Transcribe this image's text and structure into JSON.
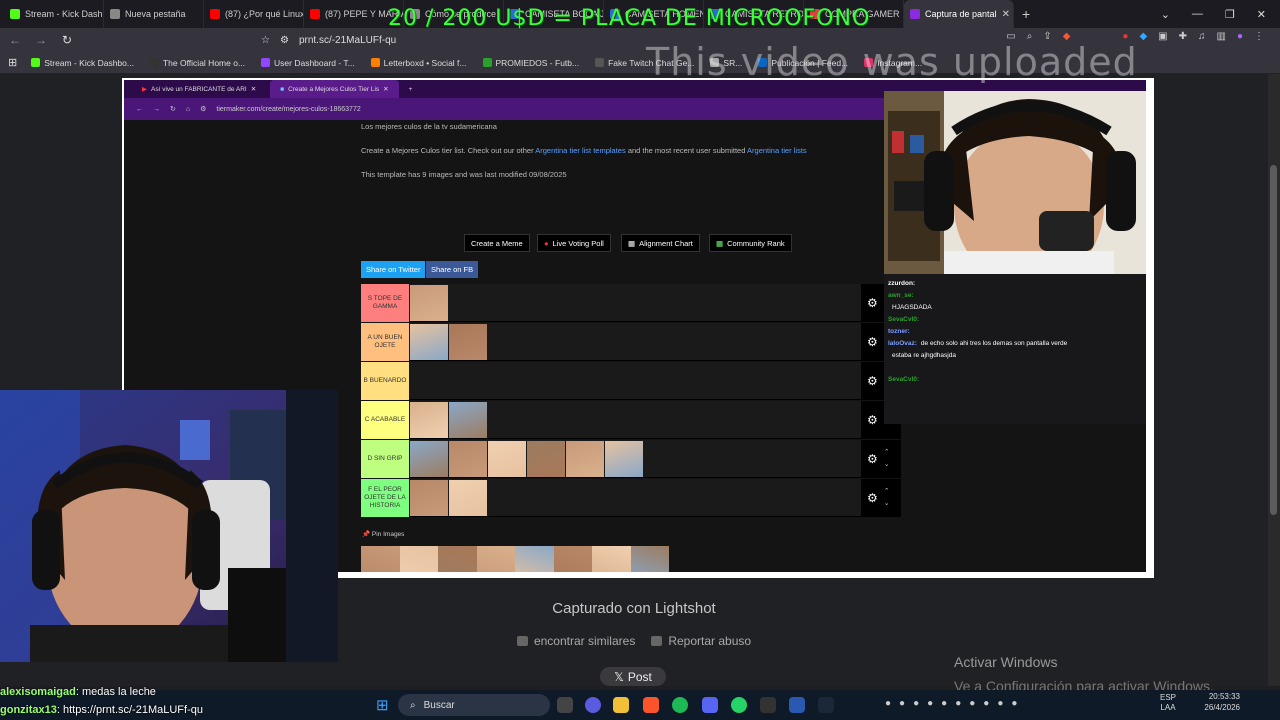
{
  "browser": {
    "tabs": [
      {
        "label": "Stream - Kick Dashboa",
        "color": "#53fc18",
        "active": false
      },
      {
        "label": "Nueva pestaña",
        "color": "#888888",
        "active": false
      },
      {
        "label": "(87) ¿Por qué Linux AH",
        "color": "#ff0000",
        "active": false
      },
      {
        "label": "(87) PEPE Y MARIAELE",
        "color": "#ff0000",
        "active": false
      },
      {
        "label": "Cómo se produce",
        "color": "#888888",
        "active": false
      },
      {
        "label": "CAMISETA BOCA JUN",
        "color": "#2b6bd6",
        "active": false
      },
      {
        "label": "CAMISETA HOMENAJ",
        "color": "#2b6bd6",
        "active": false
      },
      {
        "label": "CAMISETA RETRO - BO",
        "color": "#2b6bd6",
        "active": false
      },
      {
        "label": "COMPRA GAMER",
        "color": "#e04040",
        "active": false
      },
      {
        "label": "Captura de pantal",
        "color": "#8a2be2",
        "active": true
      }
    ],
    "url": "prnt.sc/-21MaLUFf-qu",
    "bookmarks": [
      {
        "label": "Stream - Kick Dashbo...",
        "color": "#53fc18"
      },
      {
        "label": "The Official Home o...",
        "color": "#333333"
      },
      {
        "label": "User Dashboard - T...",
        "color": "#9146ff"
      },
      {
        "label": "Letterboxd • Social f...",
        "color": "#ff8000"
      },
      {
        "label": "PROMIEDOS - Futb...",
        "color": "#2ca02c"
      },
      {
        "label": "Fake Twitch Chat Ge...",
        "color": "#555555"
      },
      {
        "label": "SR...",
        "color": "#aaaaaa"
      },
      {
        "label": "Publicación | Feed...",
        "color": "#0a66c2"
      },
      {
        "label": "Instagram...",
        "color": "#e1306c"
      }
    ]
  },
  "overlay": {
    "title": "20 / 200 U$D = PLACA DE MICROOFONO",
    "watermark": "This video was uploaded"
  },
  "inner_browser": {
    "tabs": [
      "Así vive un FABRICANTE de ARI",
      "Create a Mejores Culos Tier Lis"
    ],
    "url": "tiermaker.com/create/mejores-culos-18663772"
  },
  "tiermaker": {
    "subtitle": "Los mejores culos de la tv sudamericana",
    "desc_pre": "Create a Mejores Culos tier list. Check out our other",
    "desc_link1": "Argentina tier list templates",
    "desc_mid": "and the most recent user submitted",
    "desc_link2": "Argentina tier lists",
    "meta": "This template has 9 images and was last modified 09/08/2025",
    "buttons": [
      "Create a Meme",
      "Live Voting Poll",
      "Alignment Chart",
      "Community Rank"
    ],
    "share": [
      "Share on Twitter",
      "Share on FB"
    ],
    "tiers": [
      {
        "label": "S TOPE DE GAMMA",
        "color": "#ff7f7f",
        "images": 1
      },
      {
        "label": "A UN BUEN OJETE",
        "color": "#ffbf7f",
        "images": 2
      },
      {
        "label": "B BUENARDO",
        "color": "#ffdf7f",
        "images": 0
      },
      {
        "label": "C ACABABLE",
        "color": "#ffff7f",
        "images": 2
      },
      {
        "label": "D SIN GRIP",
        "color": "#bfff7f",
        "images": 6
      },
      {
        "label": "F EL PEOR OJETE DE LA HISTORIA",
        "color": "#7fff7f",
        "images": 2
      }
    ],
    "pin_label": "Pin Images",
    "pin_count": 8
  },
  "stream_chat": [
    {
      "user": "zzurdon:",
      "msg": "",
      "color": "#ffffff"
    },
    {
      "user": "awn_se:",
      "msg": "",
      "color": "#29a329"
    },
    {
      "user": "",
      "msg": "HJAGSDADA",
      "color": "#ff4d4d"
    },
    {
      "user": "SevaCvl0:",
      "msg": "",
      "color": "#29a329"
    },
    {
      "user": "tozner:",
      "msg": "",
      "color": "#7f9fff"
    },
    {
      "user": "laloOvaz:",
      "msg": "de echo solo ahi tres los demas son pantalla verde",
      "color": "#7f9fff"
    },
    {
      "user": "",
      "msg": "estaba re ajhgdhasjda",
      "color": "#ff4d4d"
    },
    {
      "user": "",
      "msg": "",
      "color": "#ff4d4d"
    },
    {
      "user": "SevaCvl0:",
      "msg": "",
      "color": "#29a329"
    }
  ],
  "lightshot": {
    "captured": "Capturado con Lightshot",
    "similar": "encontrar similares",
    "report": "Reportar abuso",
    "post": "Post"
  },
  "windows": {
    "activate": "Activar Windows",
    "activate_sub": "Ve a Configuración para activar Windows.",
    "search": "Buscar",
    "time": "20:53:33",
    "date": "26/4/2026",
    "lang1": "ESP",
    "lang2": "LAA"
  },
  "overlay_chat": [
    {
      "user": "alexisomaigad",
      "msg": ": medas la leche"
    },
    {
      "user": "gonzitax13",
      "msg": ": https://prnt.sc/-21MaLUFf-qu"
    }
  ]
}
